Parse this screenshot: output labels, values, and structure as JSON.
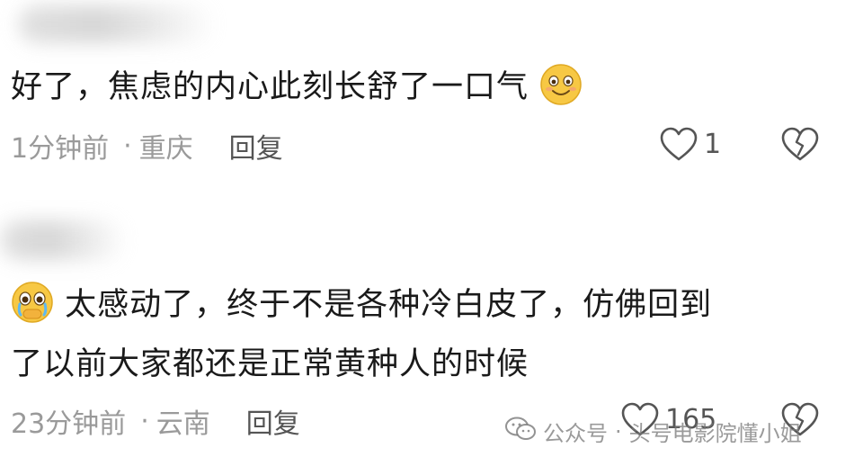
{
  "comments": [
    {
      "text": "好了，焦虑的内心此刻长舒了一口气",
      "emoji": "smiling-face-emoji",
      "time": "1分钟前",
      "location": "重庆",
      "reply_label": "回复",
      "likes": "1"
    },
    {
      "emoji": "pleading-face-emoji",
      "text_line1": "太感动了，终于不是各种冷白皮了，仿佛回到",
      "text_line2": "了以前大家都还是正常黄种人的时候",
      "time": "23分钟前",
      "location": "云南",
      "reply_label": "回复",
      "likes": "165"
    }
  ],
  "meta_separator": "·",
  "icons": {
    "like": "heart-outline-icon",
    "dislike": "broken-heart-icon",
    "watermark_logo": "wechat-icon"
  },
  "watermark": {
    "source": "公众号",
    "author": "头号电影院懂小姐"
  },
  "colors": {
    "text": "#1a1a1a",
    "meta": "#9a9a9a",
    "reply": "#555555",
    "emoji_yellow": "#f7c844"
  }
}
